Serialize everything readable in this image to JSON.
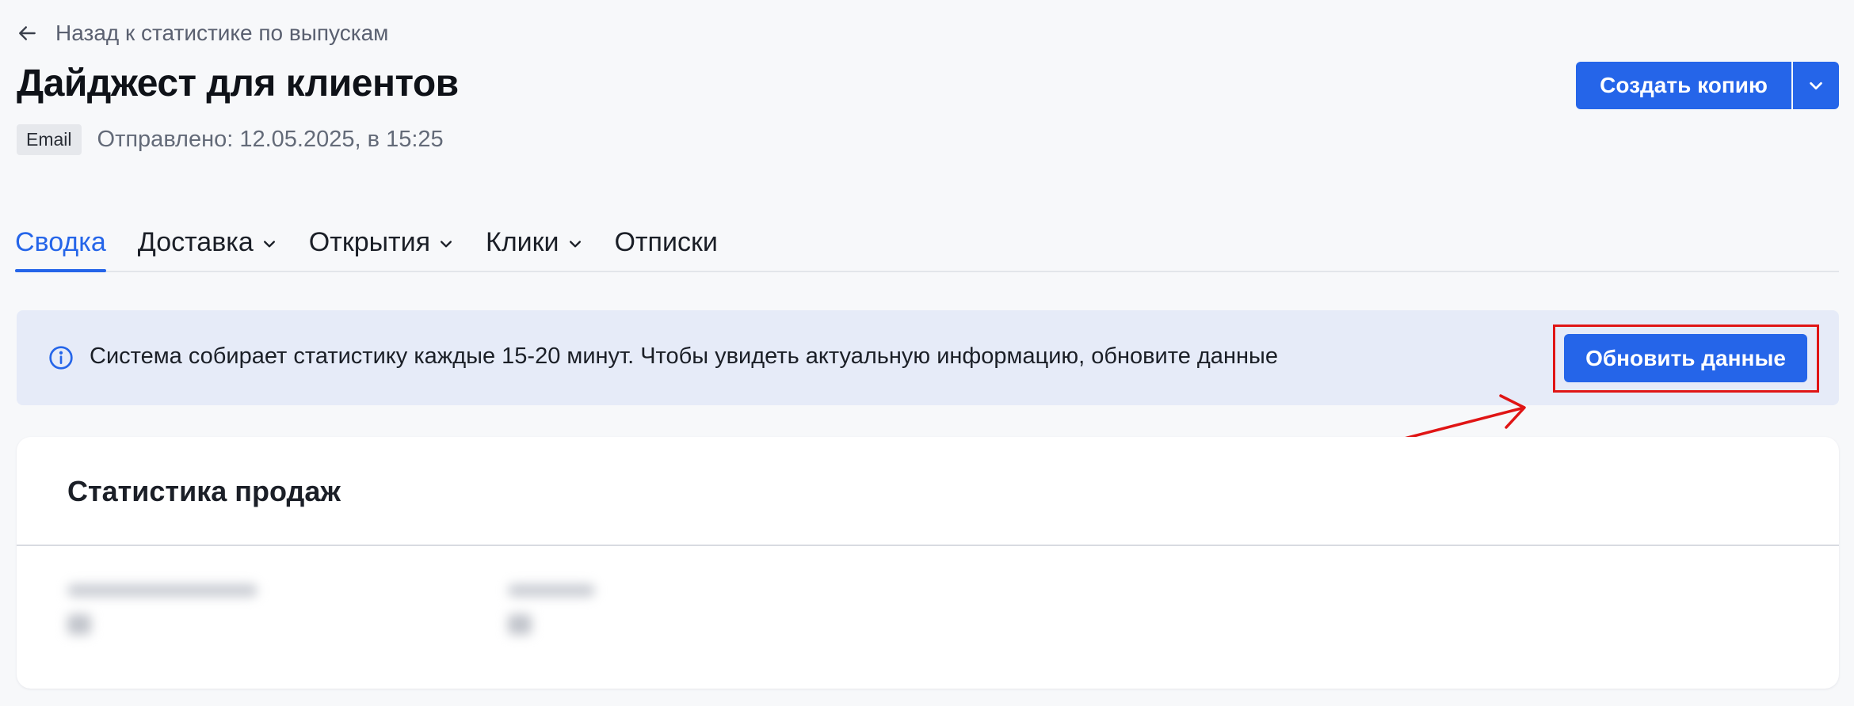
{
  "back_link": {
    "label": "Назад к статистике по выпускам",
    "icon": "arrow-left-icon"
  },
  "header": {
    "title": "Дайджест для клиентов",
    "channel_badge": "Email",
    "sent_info": "Отправлено: 12.05.2025, в 15:25"
  },
  "actions": {
    "copy_label": "Создать копию",
    "dropdown_icon": "chevron-down-icon"
  },
  "tabs": [
    {
      "label": "Сводка",
      "active": true,
      "has_dropdown": false
    },
    {
      "label": "Доставка",
      "active": false,
      "has_dropdown": true
    },
    {
      "label": "Открытия",
      "active": false,
      "has_dropdown": true
    },
    {
      "label": "Клики",
      "active": false,
      "has_dropdown": true
    },
    {
      "label": "Отписки",
      "active": false,
      "has_dropdown": false
    }
  ],
  "banner": {
    "icon": "info-icon",
    "message": "Система собирает статистику каждые 15-20 минут. Чтобы увидеть актуальную информацию, обновите данные",
    "refresh_label": "Обновить данные"
  },
  "sales_card": {
    "title": "Статистика продаж"
  },
  "colors": {
    "accent": "#2565e9",
    "banner_bg": "#e6ebf8",
    "annotation": "#e01515",
    "page_bg": "#f7f8fa"
  }
}
